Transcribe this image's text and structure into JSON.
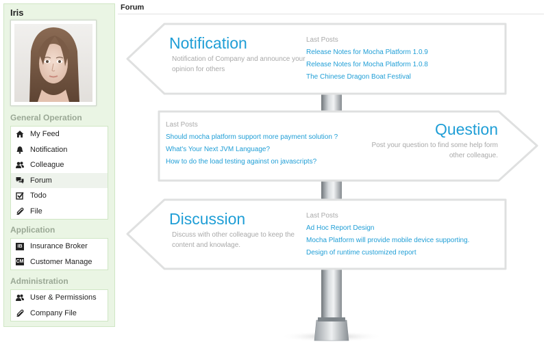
{
  "user": {
    "name": "Iris"
  },
  "sidebar": {
    "sections": [
      {
        "title": "General Operation",
        "items": [
          {
            "label": "My Feed",
            "icon": "home-icon"
          },
          {
            "label": "Notification",
            "icon": "bell-icon"
          },
          {
            "label": "Colleague",
            "icon": "users-icon"
          },
          {
            "label": "Forum",
            "icon": "chat-bubbles-icon",
            "active": true
          },
          {
            "label": "Todo",
            "icon": "checkbox-icon"
          },
          {
            "label": "File",
            "icon": "paperclip-icon"
          }
        ]
      },
      {
        "title": "Application",
        "items": [
          {
            "label": "Insurance Broker",
            "icon": "ib-badge-icon",
            "badge": "IB"
          },
          {
            "label": "Customer Manage",
            "icon": "cm-badge-icon",
            "badge": "CM"
          }
        ]
      },
      {
        "title": "Administration",
        "items": [
          {
            "label": "User & Permissions",
            "icon": "users-icon"
          },
          {
            "label": "Company File",
            "icon": "paperclip-icon"
          }
        ]
      }
    ]
  },
  "main": {
    "title": "Forum",
    "boards": [
      {
        "name": "Notification",
        "description_lines": [
          "Notification of Company and announce your",
          "opinion for others"
        ],
        "last_posts_label": "Last Posts",
        "posts": [
          "Release Notes for Mocha Platform 1.0.9",
          "Release Notes for Mocha Platform 1.0.8",
          "The Chinese Dragon Boat Festival"
        ]
      },
      {
        "name": "Question",
        "description_lines": [
          "Post your question to find some help form",
          "other colleague."
        ],
        "last_posts_label": "Last Posts",
        "posts": [
          "Should mocha platform support more payment solution ?",
          "What's Your Next JVM Language?",
          "How to do the load testing against on javascripts?"
        ]
      },
      {
        "name": "Discussion",
        "description_lines": [
          "Discuss with other colleague to keep the",
          "content and knowlage."
        ],
        "last_posts_label": "Last Posts",
        "posts": [
          "Ad Hoc Report Design",
          "Mocha Platform will provide mobile device supporting.",
          "Design of runtime customized report"
        ]
      }
    ]
  },
  "colors": {
    "accent": "#1f9ed6",
    "sidebar_bg": "#eaf5e4",
    "muted": "#a9a9a9"
  }
}
